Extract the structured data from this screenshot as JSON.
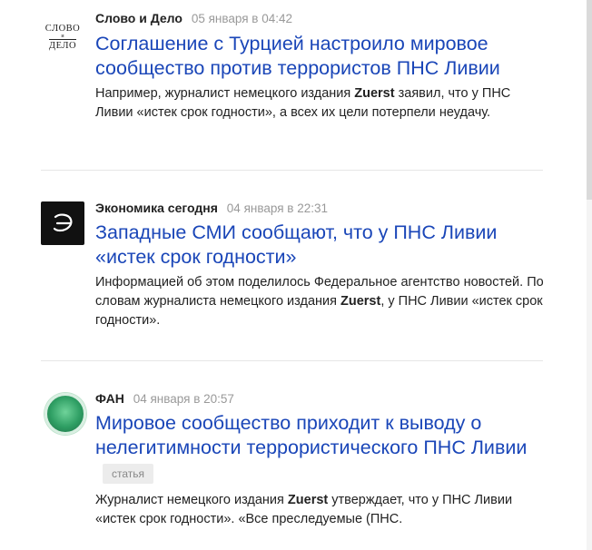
{
  "items": [
    {
      "source": "Слово и Дело",
      "time": "05 января в 04:42",
      "logo_text": [
        "СЛОВО",
        "и",
        "ДЕЛО"
      ],
      "title": "Соглашение с Турцией настроило мировое сообщество против террористов ПНС Ливии",
      "snippet": {
        "before": "Например, журналист немецкого издания ",
        "bold": "Zuerst",
        "after": " заявил, что у ПНС Ливии «истек срок годности», а всех их цели потерпели неудачу."
      }
    },
    {
      "source": "Экономика сегодня",
      "time": "04 января в 22:31",
      "logo_icon": "econ-logo-icon",
      "title": "Западные СМИ сообщают, что у ПНС Ливии «истек срок годности»",
      "snippet": {
        "before": "Информацией об этом поделилось Федеральное агентство новостей. По словам журналиста немецкого издания ",
        "bold": "Zuerst",
        "after": ", у ПНС Ливии «истек срок годности»."
      }
    },
    {
      "source": "ФАН",
      "time": "04 января в 20:57",
      "logo_icon": "fan-globe-icon",
      "title": "Мировое сообщество приходит к выводу о нелегитимности террористического ПНС Ливии",
      "badge": "статья",
      "snippet": {
        "before": "Журналист немецкого издания ",
        "bold": "Zuerst",
        "after": " утверждает, что у ПНС Ливии «истек срок годности». «Все преследуемые (ПНС."
      }
    }
  ],
  "colors": {
    "title_link": "#1a46b8",
    "time_text": "#999999",
    "divider": "#e6e6e6"
  }
}
